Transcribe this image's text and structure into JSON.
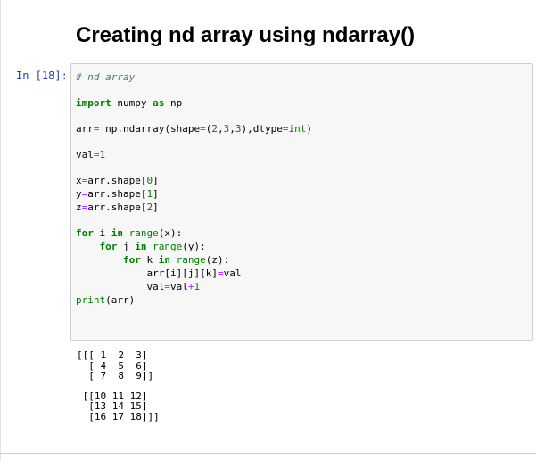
{
  "markdown": {
    "title": "Creating nd array using ndarray()"
  },
  "cell": {
    "prompt": "In [18]:",
    "code": {
      "l1": "# nd array",
      "l2": {
        "kw1": "import",
        "mod": " numpy ",
        "kw2": "as",
        "alias": " np"
      },
      "l3": {
        "a": "arr",
        "b": "=",
        "c": " np.ndarray(shape",
        "d": "=",
        "e": "(",
        "f": "2",
        "g": ",",
        "h": "3",
        "i": ",",
        "j": "3",
        "k": "),dtype",
        "l": "=",
        "m": "int",
        "n": ")"
      },
      "l4": {
        "a": "val",
        "b": "=",
        "c": "1"
      },
      "l5": {
        "a": "x",
        "b": "=",
        "c": "arr.shape[",
        "d": "0",
        "e": "]"
      },
      "l6": {
        "a": "y",
        "b": "=",
        "c": "arr.shape[",
        "d": "1",
        "e": "]"
      },
      "l7": {
        "a": "z",
        "b": "=",
        "c": "arr.shape[",
        "d": "2",
        "e": "]"
      },
      "l8": {
        "kw1": "for",
        "a": " i ",
        "kw2": "in",
        "sp": " ",
        "bi": "range",
        "b": "(x):"
      },
      "l9": {
        "ind": "    ",
        "kw1": "for",
        "a": " j ",
        "kw2": "in",
        "sp": " ",
        "bi": "range",
        "b": "(y):"
      },
      "l10": {
        "ind": "        ",
        "kw1": "for",
        "a": " k ",
        "kw2": "in",
        "sp": " ",
        "bi": "range",
        "b": "(z):"
      },
      "l11": {
        "ind": "            ",
        "a": "arr[i][j][k]",
        "b": "=",
        "c": "val"
      },
      "l12": {
        "ind": "            ",
        "a": "val",
        "b": "=",
        "c": "val",
        "d": "+",
        "e": "1"
      },
      "l13": {
        "bi": "print",
        "a": "(arr)"
      }
    },
    "output": [
      "[[[ 1  2  3]",
      "  [ 4  5  6]",
      "  [ 7  8  9]]",
      "",
      " [[10 11 12]",
      "  [13 14 15]",
      "  [16 17 18]]]"
    ]
  }
}
